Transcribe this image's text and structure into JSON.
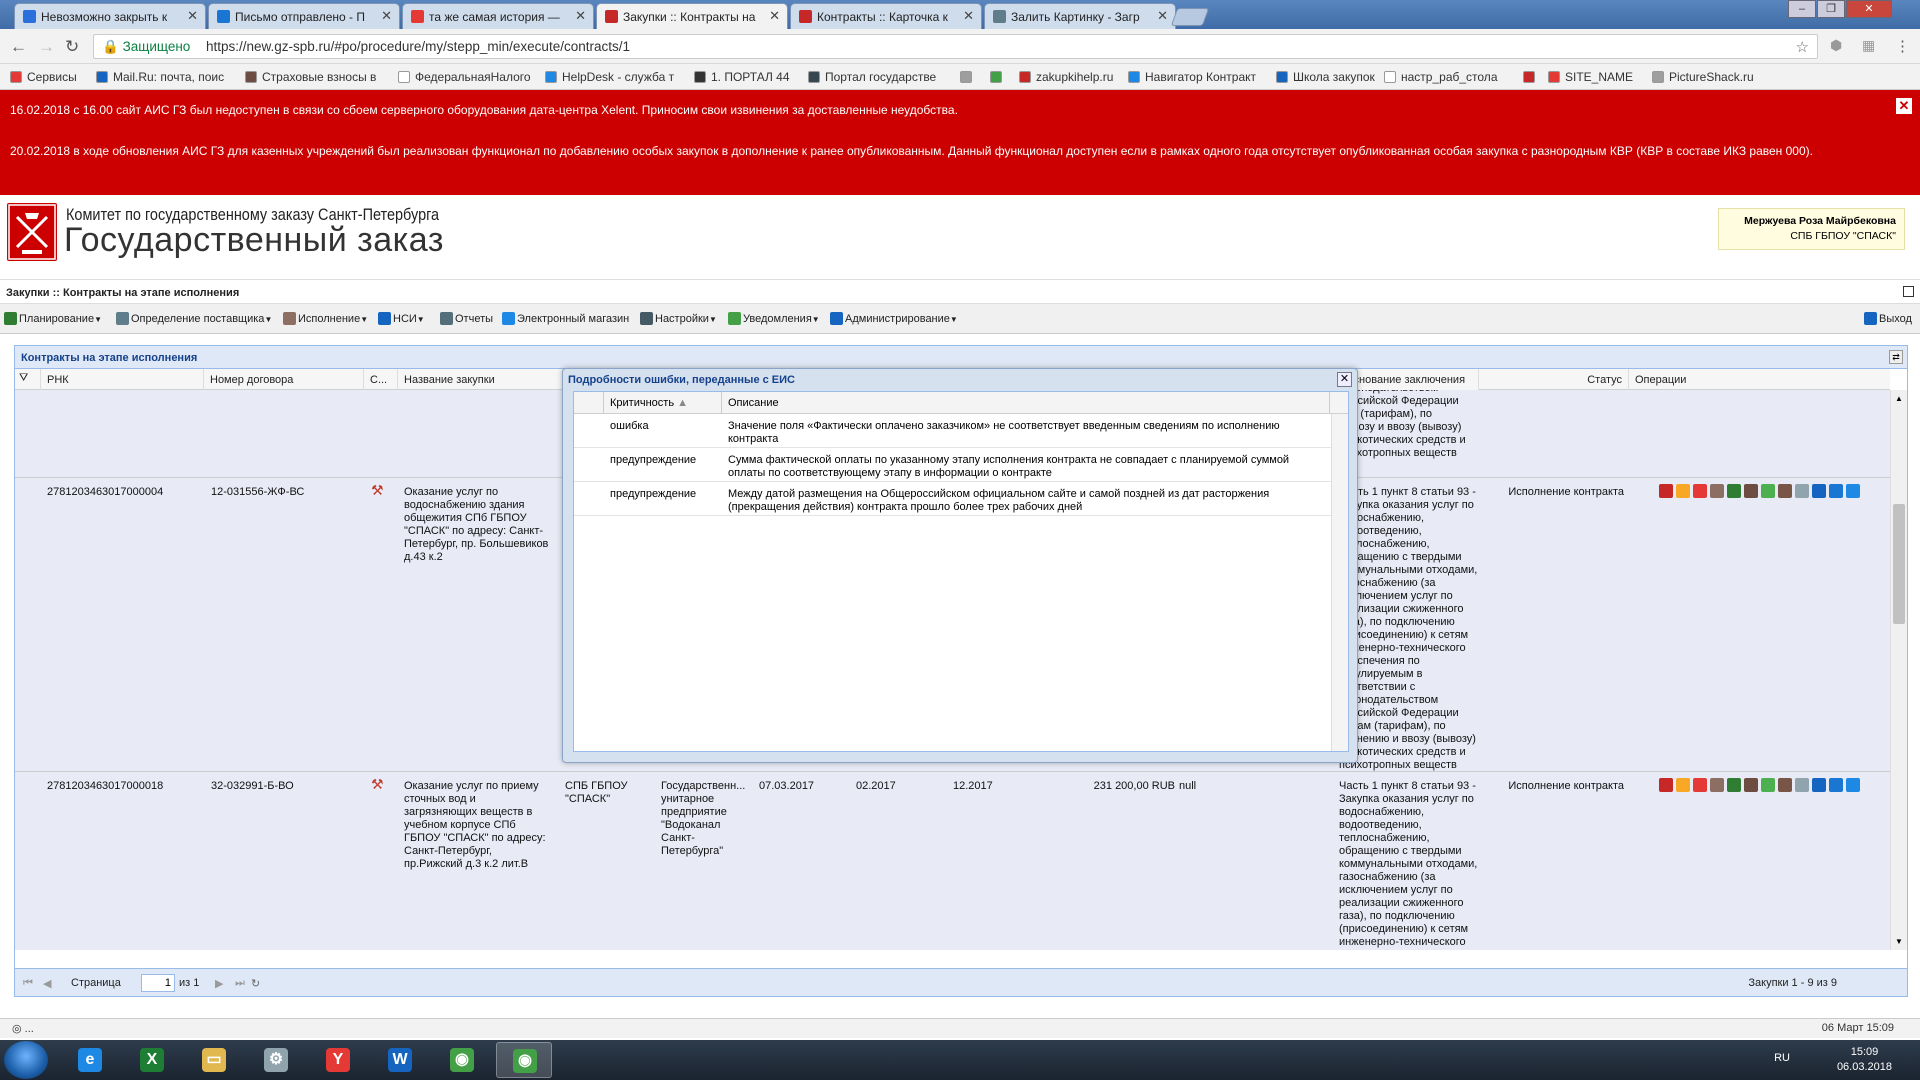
{
  "browser": {
    "tabs": [
      {
        "label": "Невозможно закрыть к",
        "fav": "#2a6fdb"
      },
      {
        "label": "Письмо отправлено - П",
        "fav": "#1976d2"
      },
      {
        "label": "та же самая история —",
        "fav": "#e53935"
      },
      {
        "label": "Закупки :: Контракты на",
        "fav": "#c62828",
        "active": true
      },
      {
        "label": "Контракты :: Карточка к",
        "fav": "#c62828"
      },
      {
        "label": "Залить Картинку - Загр",
        "fav": "#607d8b"
      }
    ],
    "secure_label": "Защищено",
    "url": "https://new.gz-spb.ru/#po/procedure/my/stepp_min/execute/contracts/1",
    "bookmarks": [
      {
        "label": "Сервисы",
        "icon": "apps-icon",
        "color": "#e53935"
      },
      {
        "label": "Mail.Ru: почта, поис",
        "icon": "mailru-icon",
        "color": "#1565c0"
      },
      {
        "label": "Страховые взносы в",
        "icon": "insurance-icon",
        "color": "#6d4c41"
      },
      {
        "label": "ФедеральнаяНалого",
        "icon": "page-icon",
        "color": "#ffffff"
      },
      {
        "label": "HelpDesk - служба т",
        "icon": "helpdesk-icon",
        "color": "#1e88e5"
      },
      {
        "label": "1. ПОРТАЛ 44",
        "icon": "portal-icon",
        "color": "#333333"
      },
      {
        "label": "Портал государстве",
        "icon": "gz-icon",
        "color": "#37474f"
      },
      {
        "label": "",
        "icon": "tools-icon",
        "color": "#9e9e9e"
      },
      {
        "label": "",
        "icon": "leaf-icon",
        "color": "#43a047"
      },
      {
        "label": "zakupkihelp.ru",
        "icon": "zakupki-icon",
        "color": "#c62828"
      },
      {
        "label": "Навигатор Контракт",
        "icon": "navigator-icon",
        "color": "#1e88e5"
      },
      {
        "label": "Школа закупок",
        "icon": "school-icon",
        "color": "#1565c0"
      },
      {
        "label": "настр_раб_стола",
        "icon": "page-icon",
        "color": "#ffffff"
      },
      {
        "label": "",
        "icon": "flag-icon",
        "color": "#c62828"
      },
      {
        "label": "SITE_NAME",
        "icon": "site-icon",
        "color": "#e53935"
      },
      {
        "label": "PictureShack.ru",
        "icon": "picture-icon",
        "color": "#9e9e9e"
      }
    ]
  },
  "notice": {
    "line1": "16.02.2018 с 16.00 сайт АИС ГЗ был недоступен в связи со сбоем серверного оборудования дата-центра Xelent. Приносим свои извинения за доставленные неудобства.",
    "line2": "20.02.2018 в ходе обновления АИС ГЗ для казенных учреждений был реализован функционал по добавлению особых закупок в дополнение к ранее опубликованным. Данный функционал доступен если в рамках одного года отсутствует опубликованная особая закупка с разнородным КВР (КВР в составе ИКЗ равен 000).",
    "close": "✕"
  },
  "header": {
    "org": "Комитет по государственному заказу Санкт-Петербурга",
    "brand": "Государственный заказ",
    "user_name": "Мержуева Роза Майрбековна",
    "user_org": "СПБ ГБПОУ \"СПАСК\""
  },
  "page_title": "Закупки :: Контракты на этапе исполнения",
  "menu": [
    {
      "label": "Планирование",
      "icon": "planning-icon",
      "color": "#2e7d32",
      "dropdown": true
    },
    {
      "label": "Определение поставщика",
      "icon": "supplier-icon",
      "color": "#607d8b",
      "dropdown": true
    },
    {
      "label": "Исполнение",
      "icon": "execution-icon",
      "color": "#8d6e63",
      "dropdown": true
    },
    {
      "label": "НСИ",
      "icon": "nsi-icon",
      "color": "#1565c0",
      "dropdown": true
    },
    {
      "label": "Отчеты",
      "icon": "reports-icon",
      "color": "#546e7a",
      "dropdown": false
    },
    {
      "label": "Электронный магазин",
      "icon": "shop-icon",
      "color": "#1e88e5",
      "dropdown": false
    },
    {
      "label": "Настройки",
      "icon": "settings-icon",
      "color": "#455a64",
      "dropdown": true
    },
    {
      "label": "Уведомления",
      "icon": "notifications-icon",
      "color": "#43a047",
      "dropdown": true
    },
    {
      "label": "Администрирование",
      "icon": "admin-icon",
      "color": "#1565c0",
      "dropdown": true
    }
  ],
  "exit_label": "Выход",
  "grid": {
    "title": "Контракты на этапе исполнения",
    "columns": {
      "rnk": "РНК",
      "number": "Номер договора",
      "s": "С...",
      "name": "Название закупки",
      "basis": "Основание заключения",
      "status": "Статус",
      "ops": "Операции"
    },
    "rows": [
      {
        "rnk": "",
        "number": "",
        "name": "",
        "basis": "законодательством\nРоссийской Федерации\nцен (тарифам), по\nвывозу и ввозу (вывозу)\nнаркотических средств и\nпсихотропных веществ",
        "status": ""
      },
      {
        "rnk": "2781203463017000004",
        "number": "12-031556-ЖФ-ВС",
        "name": "Оказание услуг по водоснабжению здания общежития СПб ГБПОУ \"СПАСК\" по адресу: Санкт-Петербург, пр. Большевиков д.43 к.2",
        "basis": "Часть 1 пункт 8 статьи 93 - Закупка оказания услуг по водоснабжению, водоотведению, теплоснабжению, обращению с твердыми коммунальными отходами, газоснабжению (за исключением услуг по реализации сжиженного газа), по подключению (присоединению) к сетям инженерно-технического обеспечения по регулируемым в соответствии с законодательством Российской Федерации ценам (тарифам), по хранению и ввозу (вывозу) наркотических средств и психотропных веществ",
        "status": "Исполнение контракта"
      },
      {
        "rnk": "2781203463017000018",
        "number": "32-032991-Б-ВО",
        "name": "Оказание услуг по приему сточных вод и загрязняющих веществ в учебном корпусе СПб ГБПОУ \"СПАСК\" по адресу: Санкт-Петербург, пр.Рижский д.3 к.2 лит.В",
        "customer": "СПБ ГБПОУ \"СПАСК\"",
        "supplier": "Государственн... унитарное предприятие \"Водоканал Санкт-Петербурга\"",
        "date": "07.03.2017",
        "start": "02.2017",
        "end": "12.2017",
        "price": "231 200,00 RUB",
        "extra": "null",
        "basis": "Часть 1 пункт 8 статьи 93 - Закупка оказания услуг по водоснабжению, водоотведению, теплоснабжению, обращению с твердыми коммунальными отходами, газоснабжению (за исключением услуг по реализации сжиженного газа), по подключению (присоединению) к сетям инженерно-технического обеспечения по",
        "status": "Исполнение контракта"
      }
    ],
    "op_colors": [
      "#c62828",
      "#f9a825",
      "#e53935",
      "#8d6e63",
      "#2e7d32",
      "#6d4c41",
      "#4caf50",
      "#795548",
      "#90a4ae",
      "#1565c0",
      "#1976d2",
      "#1e88e5"
    ],
    "pager": {
      "page_label": "Страница",
      "page_value": "1",
      "of_label": "из 1",
      "summary": "Закупки 1 - 9 из 9"
    }
  },
  "dialog": {
    "title": "Подробности ошибки, переданные с ЕИС",
    "col_severity": "Критичность",
    "col_description": "Описание",
    "rows": [
      {
        "severity": "ошибка",
        "description": "Значение поля «Фактически оплачено заказчиком» не соответствует введенным сведениям по исполнению контракта"
      },
      {
        "severity": "предупреждение",
        "description": "Сумма фактической оплаты по указанному этапу исполнения контракта не совпадает с планируемой суммой оплаты по соответствующему этапу в информации о контракте"
      },
      {
        "severity": "предупреждение",
        "description": "Между датой размещения на Общероссийском официальном сайте и самой поздней из дат расторжения (прекращения действия) контракта прошло более трех рабочих дней"
      }
    ]
  },
  "status": {
    "left": "...",
    "date": "06 Март 15:09"
  },
  "taskbar": {
    "lang": "RU",
    "time": "15:09",
    "date": "06.03.2018",
    "apps": [
      {
        "name": "ie-icon",
        "color": "#1e88e5",
        "glyph": "e"
      },
      {
        "name": "excel-icon",
        "color": "#1e7e34",
        "glyph": "X"
      },
      {
        "name": "explorer-icon",
        "color": "#e0b84f",
        "glyph": "▭"
      },
      {
        "name": "tool-icon",
        "color": "#90a4ae",
        "glyph": "⚙"
      },
      {
        "name": "yandex-icon",
        "color": "#e53935",
        "glyph": "Y"
      },
      {
        "name": "word-icon",
        "color": "#1565c0",
        "glyph": "W"
      },
      {
        "name": "chrome-icon",
        "color": "#43a047",
        "glyph": "◉"
      },
      {
        "name": "chrome-active-icon",
        "color": "#43a047",
        "glyph": "◉",
        "active": true
      }
    ]
  }
}
